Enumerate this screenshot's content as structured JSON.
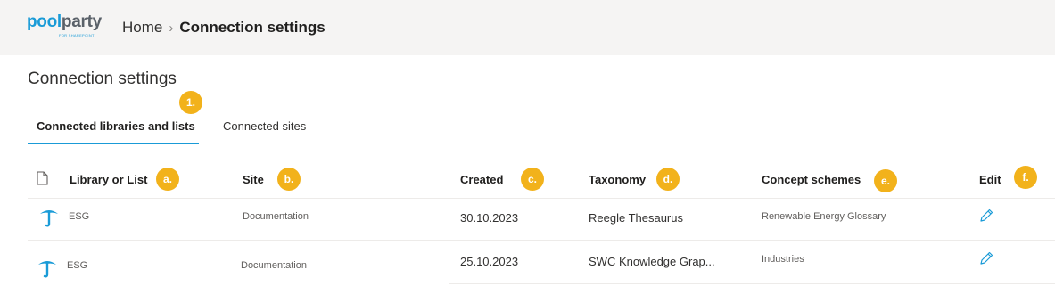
{
  "header": {
    "logo_pool": "pool",
    "logo_party": "party",
    "logo_sub": "FOR SHAREPOINT",
    "breadcrumb_home": "Home",
    "breadcrumb_sep": "›",
    "breadcrumb_current": "Connection settings"
  },
  "page": {
    "title": "Connection settings"
  },
  "tabs": [
    {
      "label": "Connected libraries and lists",
      "active": true
    },
    {
      "label": "Connected sites",
      "active": false
    }
  ],
  "markers": [
    "1.",
    "a.",
    "b.",
    "c.",
    "d.",
    "e.",
    "f."
  ],
  "table": {
    "columns": [
      "Library or List",
      "Site",
      "Created",
      "Taxonomy",
      "Concept schemes",
      "Edit"
    ],
    "rows": [
      {
        "library": "ESG",
        "site": "Documentation",
        "created": "30.10.2023",
        "taxonomy": "Reegle Thesaurus",
        "concept_schemes": "Renewable Energy Glossary"
      },
      {
        "library": "ESG",
        "site": "Documentation",
        "created": "25.10.2023",
        "taxonomy": "SWC Knowledge Grap...",
        "concept_schemes": "Industries"
      }
    ]
  },
  "icons": {
    "library": "poolparty-umbrella-icon",
    "edit": "pencil-icon",
    "document": "document-icon"
  },
  "colors": {
    "brand_blue": "#1a9bd7",
    "marker_yellow": "#f2b21b",
    "topbar_bg": "#f5f4f3"
  }
}
